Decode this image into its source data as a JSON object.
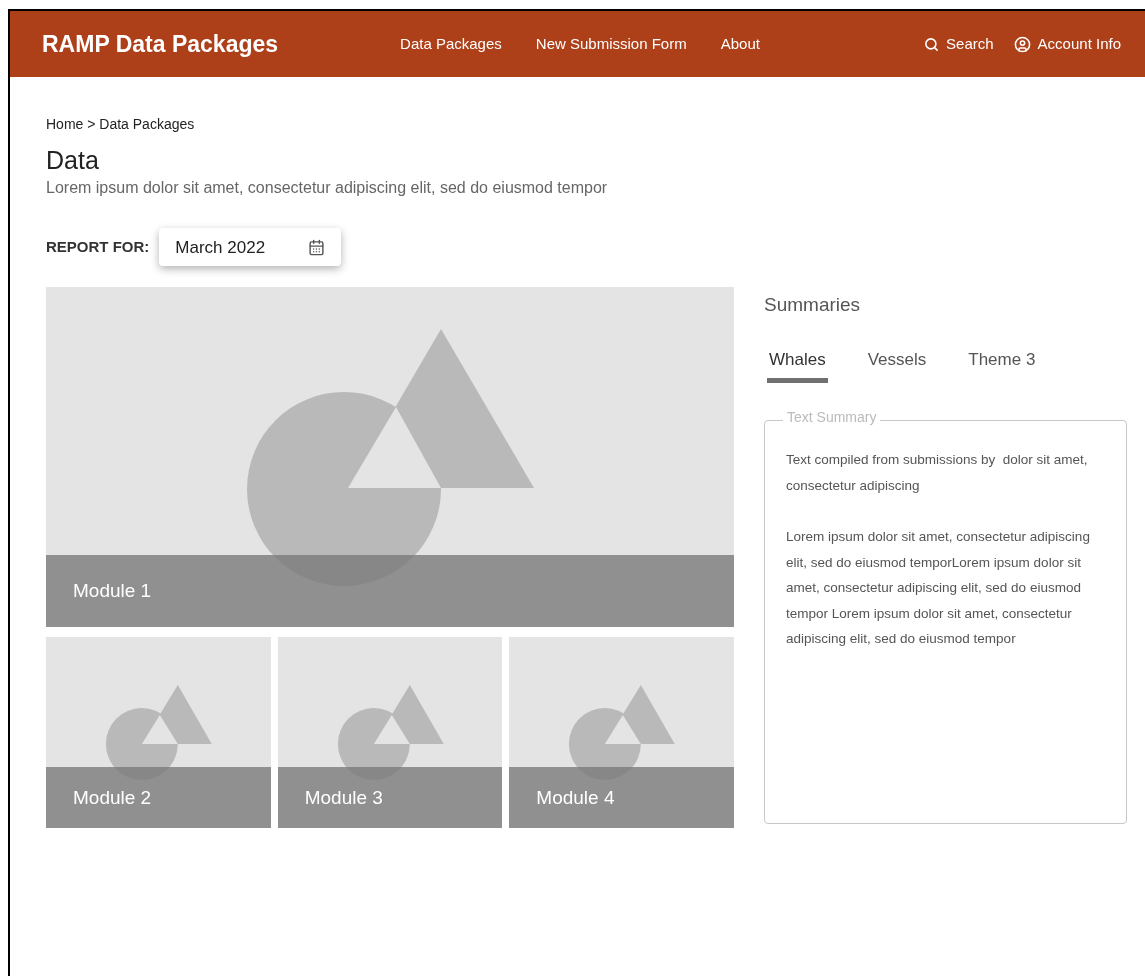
{
  "header": {
    "title": "RAMP Data Packages",
    "nav": [
      "Data Packages",
      "New Submission Form",
      "About"
    ],
    "search": "Search",
    "account": "Account Info"
  },
  "breadcrumb": "Home > Data Packages",
  "page": {
    "title": "Data",
    "subtitle": "Lorem ipsum dolor sit amet, consectetur adipiscing elit, sed do eiusmod tempor"
  },
  "report": {
    "label": "REPORT FOR:",
    "value": "March 2022"
  },
  "modules": [
    {
      "label": "Module 1"
    },
    {
      "label": "Module 2"
    },
    {
      "label": "Module 3"
    },
    {
      "label": "Module 4"
    }
  ],
  "summaries": {
    "title": "Summaries",
    "tabs": [
      {
        "label": "Whales",
        "selected": true
      },
      {
        "label": "Vessels",
        "selected": false
      },
      {
        "label": "Theme 3",
        "selected": false
      }
    ],
    "field_label": "Text Summary",
    "paragraphs": [
      "Text compiled from submissions by  dolor sit amet, consectetur adipiscing",
      "Lorem ipsum dolor sit amet, consectetur adipiscing elit, sed do eiusmod temporLorem ipsum dolor sit amet, consectetur adipiscing elit, sed do eiusmod tempor Lorem ipsum dolor sit amet, consectetur adipiscing elit, sed do eiusmod tempor"
    ]
  }
}
